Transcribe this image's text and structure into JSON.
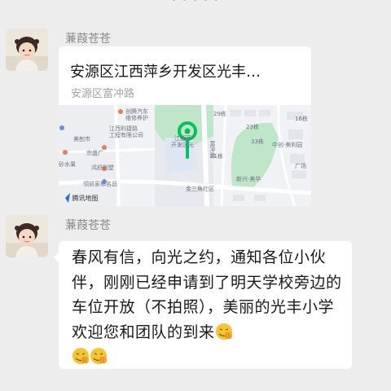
{
  "header": {
    "cut_text": "• • • • •"
  },
  "messages": [
    {
      "sender": "蒹葭苍苍",
      "type": "location",
      "location": {
        "title": "安源区江西萍乡开发区光丰…",
        "address": "安源区富冲路",
        "map_labels": {
          "a": "创腾汽车",
          "b": "维修养护",
          "c": "江西利捷路",
          "d": "工程有限公司",
          "e": "美刨市",
          "f": "江西萍",
          "g": "开发区光",
          "h": "29栋",
          "i": "23栋",
          "j": "16栋",
          "k": "富冲路",
          "l": "31栋",
          "m": "新兴·美华",
          "n": "金三角社区",
          "o": "领凯家私名品",
          "p": "宗盛广",
          "q": "鸿舒别墅",
          "r": "砂水果",
          "s": "广场",
          "t": "33栋",
          "u": "中创·美利园"
        },
        "map_credit": "腾讯地图"
      }
    },
    {
      "sender": "蒹葭苍苍",
      "type": "text",
      "text": "春风有信，向光之约，通知各位小伙伴，刚刚已经申请到了明天学校旁边的车位开放（不拍照），美丽的光丰小学欢迎您和团队的到来",
      "emoji_name": "fist-salute-emoji",
      "trailing_emoji_count": 2
    }
  ],
  "colors": {
    "background": "#ededed",
    "bubble": "#ffffff",
    "pin": "#07c160",
    "map_green": "#bfe6c9",
    "map_road": "#ffffff"
  }
}
